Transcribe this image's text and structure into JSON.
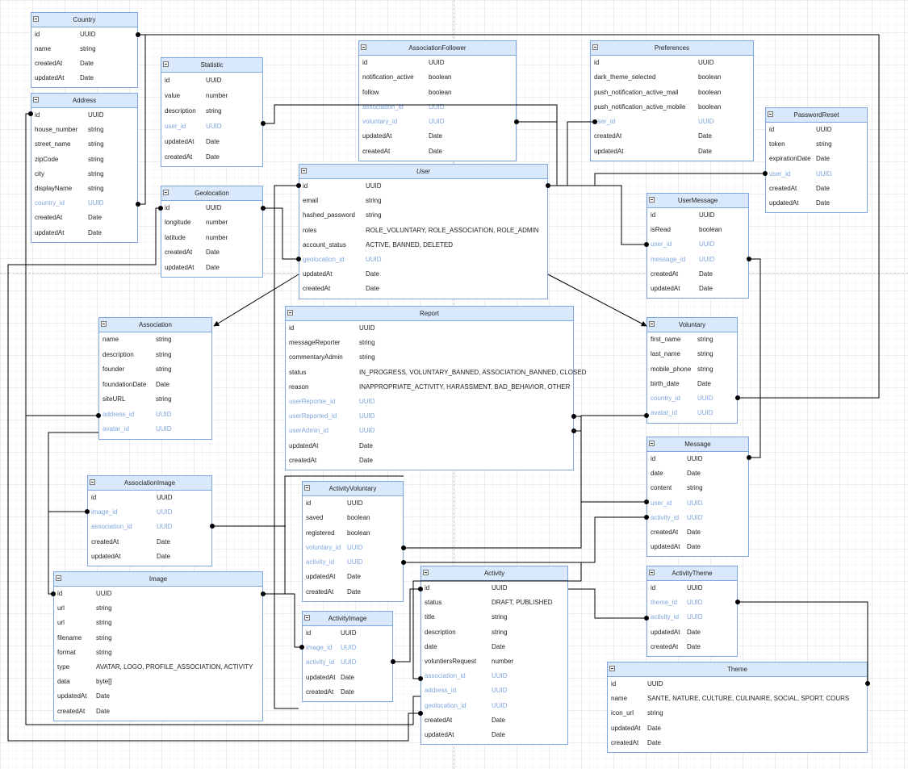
{
  "diagram": {
    "entities": [
      {
        "id": "country",
        "title": "Country",
        "fields": [
          {
            "name": "id",
            "type": "UUID"
          },
          {
            "name": "name",
            "type": "string"
          },
          {
            "name": "createdAt",
            "type": "Date"
          },
          {
            "name": "updatedAt",
            "type": "Date"
          }
        ]
      },
      {
        "id": "address",
        "title": "Address",
        "fields": [
          {
            "name": "id",
            "type": "UUID"
          },
          {
            "name": "house_number",
            "type": "string"
          },
          {
            "name": "street_name",
            "type": "string"
          },
          {
            "name": "zipCode",
            "type": "string"
          },
          {
            "name": "city",
            "type": "string"
          },
          {
            "name": "displayName",
            "type": "string"
          },
          {
            "name": "country_id",
            "type": "UUID",
            "fk": true
          },
          {
            "name": "createdAt",
            "type": "Date"
          },
          {
            "name": "updatedAt",
            "type": "Date"
          }
        ]
      },
      {
        "id": "statistic",
        "title": "Statistic",
        "fields": [
          {
            "name": "id",
            "type": "UUID"
          },
          {
            "name": "value",
            "type": "number"
          },
          {
            "name": "description",
            "type": "string"
          },
          {
            "name": "user_id",
            "type": "UUID",
            "fk": true
          },
          {
            "name": "updatedAt",
            "type": "Date"
          },
          {
            "name": "createdAt",
            "type": "Date"
          }
        ]
      },
      {
        "id": "geolocation",
        "title": "Geolocation",
        "fields": [
          {
            "name": "id",
            "type": "UUID"
          },
          {
            "name": "longitude",
            "type": "number"
          },
          {
            "name": "latitude",
            "type": "number"
          },
          {
            "name": "createdAt",
            "type": "Date"
          },
          {
            "name": "updatedAt",
            "type": "Date"
          }
        ]
      },
      {
        "id": "associationFollower",
        "title": "AssociationFollower",
        "fields": [
          {
            "name": "id",
            "type": "UUID"
          },
          {
            "name": "notification_active",
            "type": "boolean"
          },
          {
            "name": "follow",
            "type": "boolean"
          },
          {
            "name": "association_id",
            "type": "UUID",
            "fk": true
          },
          {
            "name": "voluntary_id",
            "type": "UUID",
            "fk": true
          },
          {
            "name": "updatedAt",
            "type": "Date"
          },
          {
            "name": "createdAt",
            "type": "Date"
          }
        ]
      },
      {
        "id": "preferences",
        "title": "Preferences",
        "fields": [
          {
            "name": "id",
            "type": "UUID"
          },
          {
            "name": "dark_theme_selected",
            "type": "boolean"
          },
          {
            "name": "push_notification_active_mail",
            "type": "boolean"
          },
          {
            "name": "push_notification_active_mobile",
            "type": "boolean"
          },
          {
            "name": "user_id",
            "type": "UUID",
            "fk": true
          },
          {
            "name": "createdAt",
            "type": "Date"
          },
          {
            "name": "updatedAt",
            "type": "Date"
          }
        ]
      },
      {
        "id": "passwordReset",
        "title": "PasswordReset",
        "fields": [
          {
            "name": "id",
            "type": "UUID"
          },
          {
            "name": "token",
            "type": "string"
          },
          {
            "name": "expirationDate",
            "type": "Date"
          },
          {
            "name": "user_id",
            "type": "UUID",
            "fk": true
          },
          {
            "name": "createdAt",
            "type": "Date"
          },
          {
            "name": "updatedAt",
            "type": "Date"
          }
        ]
      },
      {
        "id": "user",
        "title": "User",
        "fields": [
          {
            "name": "id",
            "type": "UUID"
          },
          {
            "name": "email",
            "type": "string"
          },
          {
            "name": "hashed_password",
            "type": "string"
          },
          {
            "name": "roles",
            "type": "ROLE_VOLUNTARY, ROLE_ASSOCIATION, ROLE_ADMIN"
          },
          {
            "name": "account_status",
            "type": "ACTIVE, BANNED, DELETED"
          },
          {
            "name": "geolocation_id",
            "type": "UUID",
            "fk": true
          },
          {
            "name": "updatedAt",
            "type": "Date"
          },
          {
            "name": "createdAt",
            "type": "Date"
          }
        ]
      },
      {
        "id": "userMessage",
        "title": "UserMessage",
        "fields": [
          {
            "name": "id",
            "type": "UUID"
          },
          {
            "name": "isRead",
            "type": "boolean"
          },
          {
            "name": "user_id",
            "type": "UUID",
            "fk": true
          },
          {
            "name": "message_id",
            "type": "UUID",
            "fk": true
          },
          {
            "name": "createdAt",
            "type": "Date"
          },
          {
            "name": "updatedAt",
            "type": "Date"
          }
        ]
      },
      {
        "id": "association",
        "title": "Association",
        "fields": [
          {
            "name": "name",
            "type": "string"
          },
          {
            "name": "description",
            "type": "string"
          },
          {
            "name": "founder",
            "type": "string"
          },
          {
            "name": "foundationDate",
            "type": "Date"
          },
          {
            "name": "siteURL",
            "type": "string"
          },
          {
            "name": "address_id",
            "type": "UUID",
            "fk": true
          },
          {
            "name": "avatar_id",
            "type": "UUID",
            "fk": true
          }
        ]
      },
      {
        "id": "report",
        "title": "Report",
        "fields": [
          {
            "name": "id",
            "type": "UUID"
          },
          {
            "name": "messageReporter",
            "type": "string"
          },
          {
            "name": "commentaryAdmin",
            "type": "string"
          },
          {
            "name": "status",
            "type": "IN_PROGRESS, VOLUNTARY_BANNED, ASSOCIATION_BANNED, CLOSED"
          },
          {
            "name": "reason",
            "type": "INAPPROPRIATE_ACTIVITY, HARASSMENT, BAD_BEHAVIOR, OTHER"
          },
          {
            "name": "userReporter_id",
            "type": "UUID",
            "fk": true
          },
          {
            "name": "userReported_id",
            "type": "UUID",
            "fk": true
          },
          {
            "name": "userAdmin_id",
            "type": "UUID",
            "fk": true
          },
          {
            "name": "updatedAt",
            "type": "Date"
          },
          {
            "name": "createdAt",
            "type": "Date"
          }
        ]
      },
      {
        "id": "voluntary",
        "title": "Voluntary",
        "fields": [
          {
            "name": "first_name",
            "type": "string"
          },
          {
            "name": "last_name",
            "type": "string"
          },
          {
            "name": "mobile_phone",
            "type": "string"
          },
          {
            "name": "birth_date",
            "type": "Date"
          },
          {
            "name": "country_id",
            "type": "UUID",
            "fk": true
          },
          {
            "name": "avatar_id",
            "type": "UUID",
            "fk": true
          }
        ]
      },
      {
        "id": "message",
        "title": "Message",
        "fields": [
          {
            "name": "id",
            "type": "UUID"
          },
          {
            "name": "date",
            "type": "Date"
          },
          {
            "name": "content",
            "type": "string"
          },
          {
            "name": "user_id",
            "type": "UUID",
            "fk": true
          },
          {
            "name": "activity_id",
            "type": "UUID",
            "fk": true
          },
          {
            "name": "createdAt",
            "type": "Date"
          },
          {
            "name": "updatedAt",
            "type": "Date"
          }
        ]
      },
      {
        "id": "associationImage",
        "title": "AssociationImage",
        "fields": [
          {
            "name": "id",
            "type": "UUID"
          },
          {
            "name": "image_id",
            "type": "UUID",
            "fk": true
          },
          {
            "name": "association_id",
            "type": "UUID",
            "fk": true
          },
          {
            "name": "createdAt",
            "type": "Date"
          },
          {
            "name": "updatedAt",
            "type": "Date"
          }
        ]
      },
      {
        "id": "activityVoluntary",
        "title": "ActivityVoluntary",
        "fields": [
          {
            "name": "id",
            "type": "UUID"
          },
          {
            "name": "saved",
            "type": "boolean"
          },
          {
            "name": "registered",
            "type": "boolean"
          },
          {
            "name": "voluntary_id",
            "type": "UUID",
            "fk": true
          },
          {
            "name": "activity_id",
            "type": "UUID",
            "fk": true
          },
          {
            "name": "updatedAt",
            "type": "Date"
          },
          {
            "name": "createdAt",
            "type": "Date"
          }
        ]
      },
      {
        "id": "image",
        "title": "Image",
        "fields": [
          {
            "name": "id",
            "type": "UUID"
          },
          {
            "name": "url",
            "type": "string"
          },
          {
            "name": "url",
            "type": "string"
          },
          {
            "name": "filename",
            "type": "string"
          },
          {
            "name": "format",
            "type": "string"
          },
          {
            "name": "type",
            "type": "AVATAR, LOGO, PROFILE_ASSOCIATION, ACTIVITY"
          },
          {
            "name": "data",
            "type": "byte[]"
          },
          {
            "name": "updatedAt",
            "type": "Date"
          },
          {
            "name": "createdAt",
            "type": "Date"
          }
        ]
      },
      {
        "id": "activity",
        "title": "Activity",
        "fields": [
          {
            "name": "id",
            "type": "UUID"
          },
          {
            "name": "status",
            "type": "DRAFT, PUBLISHED"
          },
          {
            "name": "title",
            "type": "string"
          },
          {
            "name": "description",
            "type": "string"
          },
          {
            "name": "date",
            "type": "Date"
          },
          {
            "name": "voluntiersRequest",
            "type": "number"
          },
          {
            "name": "association_id",
            "type": "UUID",
            "fk": true
          },
          {
            "name": "address_id",
            "type": "UUID",
            "fk": true
          },
          {
            "name": "geolocation_id",
            "type": "UUID",
            "fk": true
          },
          {
            "name": "createdAt",
            "type": "Date"
          },
          {
            "name": "updatedAt",
            "type": "Date"
          }
        ]
      },
      {
        "id": "activityImage",
        "title": "ActivityImage",
        "fields": [
          {
            "name": "id",
            "type": "UUID"
          },
          {
            "name": "image_id",
            "type": "UUID",
            "fk": true
          },
          {
            "name": "activity_id",
            "type": "UUID",
            "fk": true
          },
          {
            "name": "updatedAt",
            "type": "Date"
          },
          {
            "name": "createdAt",
            "type": "Date"
          }
        ]
      },
      {
        "id": "activityTheme",
        "title": "ActivityTheme",
        "fields": [
          {
            "name": "id",
            "type": "UUID"
          },
          {
            "name": "theme_id",
            "type": "UUID",
            "fk": true
          },
          {
            "name": "activity_id",
            "type": "UUID",
            "fk": true
          },
          {
            "name": "updatedAt",
            "type": "Date"
          },
          {
            "name": "createdAt",
            "type": "Date"
          }
        ]
      },
      {
        "id": "theme",
        "title": "Theme",
        "fields": [
          {
            "name": "id",
            "type": "UUID"
          },
          {
            "name": "name",
            "type": "SANTE, NATURE, CULTURE, CULINAIRE, SOCIAL, SPORT, COURS"
          },
          {
            "name": "icon_url",
            "type": "string"
          },
          {
            "name": "updatedAt",
            "type": "Date"
          },
          {
            "name": "createdAt",
            "type": "Date"
          }
        ]
      }
    ],
    "colors": {
      "entity_header_fill": "#dae8fc",
      "entity_border": "#7ea6e0",
      "foreign_key_text": "#7ea6e0",
      "connector": "#000000"
    }
  }
}
